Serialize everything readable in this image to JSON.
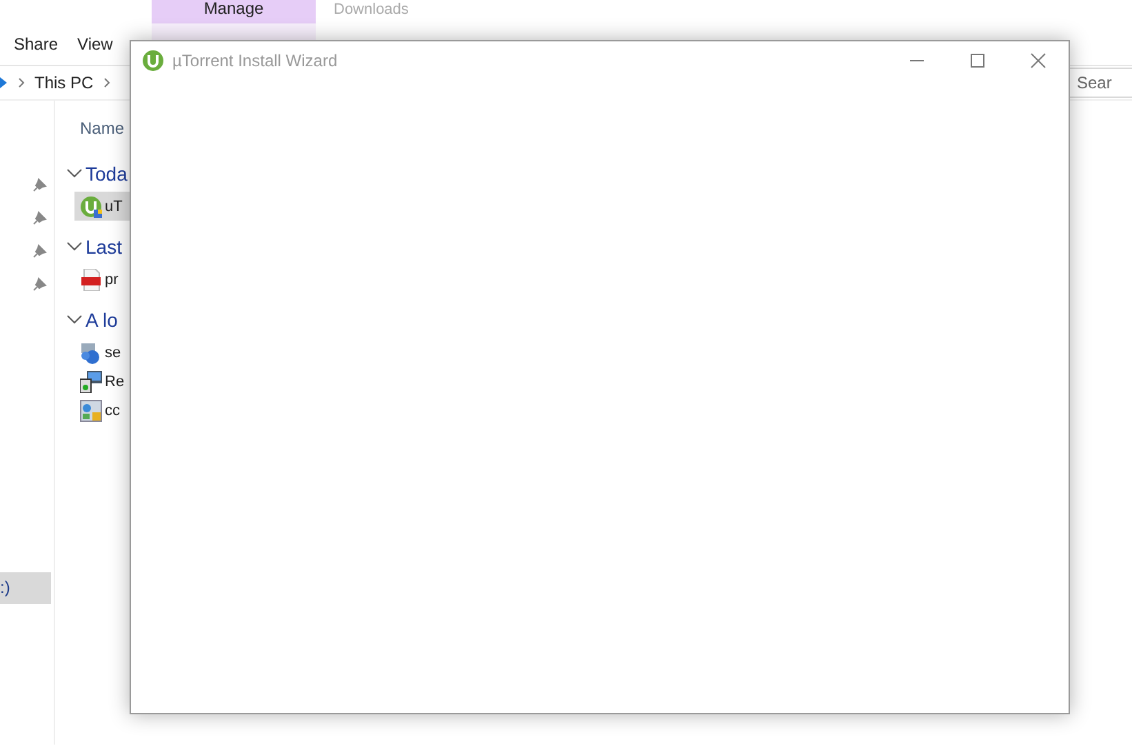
{
  "ribbon": {
    "context_tab": {
      "label": "Manage"
    },
    "window_title": "Downloads",
    "tabs": [
      {
        "label": "Share"
      },
      {
        "label": "View"
      }
    ]
  },
  "address": {
    "crumbs": [
      "This PC"
    ]
  },
  "search": {
    "placeholder": "Sear"
  },
  "nav": {
    "items": [
      {
        "label": ":)",
        "selected": true
      }
    ]
  },
  "columns": [
    "Name"
  ],
  "groups": [
    {
      "label": "Toda",
      "expanded": true,
      "files": [
        {
          "name": "uT",
          "kind": "torrent",
          "selected": true
        }
      ]
    },
    {
      "label": "Last",
      "expanded": true,
      "files": [
        {
          "name": "pr",
          "kind": "pdf",
          "selected": false
        }
      ]
    },
    {
      "label": "A lo",
      "expanded": true,
      "files": [
        {
          "name": "se",
          "kind": "setup",
          "selected": false
        },
        {
          "name": "Re",
          "kind": "installer",
          "selected": false
        },
        {
          "name": "cc",
          "kind": "control",
          "selected": false
        }
      ]
    }
  ],
  "dialog": {
    "title": "µTorrent Install Wizard"
  }
}
